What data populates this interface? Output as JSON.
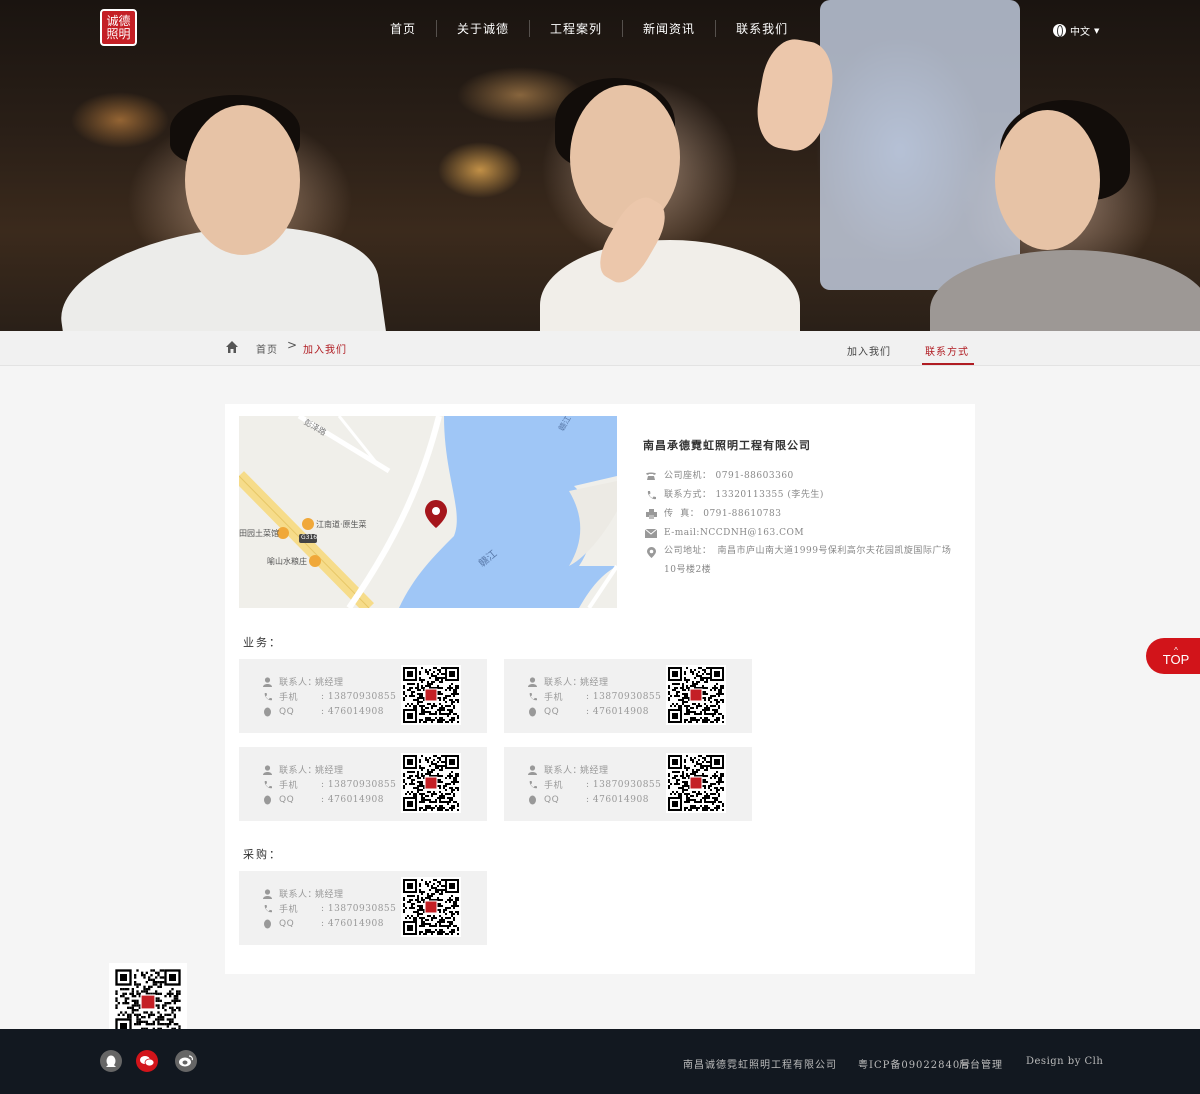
{
  "header": {
    "logo_text": "诚德照明",
    "nav": [
      {
        "label": "首页"
      },
      {
        "label": "关于诚德"
      },
      {
        "label": "工程案列"
      },
      {
        "label": "新闻资讯"
      },
      {
        "label": "联系我们"
      }
    ],
    "language": "中文"
  },
  "breadcrumb": {
    "home": "首页",
    "separator": ">",
    "current": "加入我们"
  },
  "subtabs": [
    {
      "label": "加入我们",
      "active": false
    },
    {
      "label": "联系方式",
      "active": true
    }
  ],
  "map": {
    "labels": {
      "road1": "彭泽路",
      "river1": "赣江",
      "river2": "赣江",
      "poi1": "江南道·原生菜",
      "poi2": "田园土菜馆",
      "poi3": "喻山水粮庄",
      "road_badge": "G316"
    }
  },
  "company": {
    "name": "南昌承德霓虹照明工程有限公司",
    "info": [
      {
        "icon": "phone-icon",
        "label": "公司座机：",
        "value": "0791-88603360"
      },
      {
        "icon": "mobile-icon",
        "label": "联系方式：",
        "value": "13320113355 (李先生)"
      },
      {
        "icon": "fax-icon",
        "label": "传  真：",
        "value": "0791-88610783"
      },
      {
        "icon": "mail-icon",
        "label": "",
        "value": "E-mail:NCCDNH@163.COM"
      },
      {
        "icon": "location-icon",
        "label": "公司地址：",
        "value": "南昌市庐山南大道1999号保利高尔夫花园凯旋国际广场10号楼2楼"
      }
    ]
  },
  "sections": {
    "business_label": "业务：",
    "purchase_label": "采购："
  },
  "contact_labels": {
    "person": "联系人：",
    "phone": "手机",
    "qq": "QQ"
  },
  "business_contacts": [
    {
      "person": "姚经理",
      "phone": ": 13870930855",
      "qq": ": 476014908"
    },
    {
      "person": "姚经理",
      "phone": ": 13870930855",
      "qq": ": 476014908"
    },
    {
      "person": "姚经理",
      "phone": ": 13870930855",
      "qq": ": 476014908"
    },
    {
      "person": "姚经理",
      "phone": ": 13870930855",
      "qq": ": 476014908"
    }
  ],
  "purchase_contacts": [
    {
      "person": "姚经理",
      "phone": ": 13870930855",
      "qq": ": 476014908"
    }
  ],
  "top_button": "TOP",
  "footer": {
    "company": "南昌诚德霓虹照明工程有限公司",
    "icp": "粤ICP备09022840号",
    "admin": "后台管理",
    "design": "Design by Clh"
  },
  "colors": {
    "accent": "#b01c22",
    "top_button": "#d2141a",
    "footer_bg": "#121820"
  }
}
